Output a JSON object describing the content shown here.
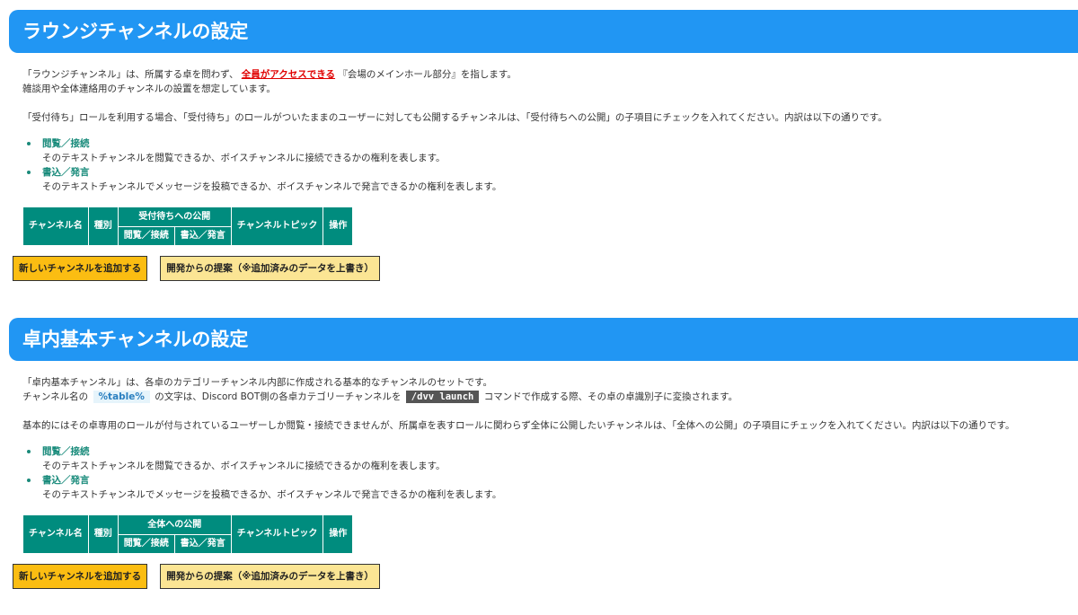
{
  "sections": [
    {
      "title": "ラウンジチャンネルの設定",
      "intro_a": "「ラウンジチャンネル」は、所属する卓を問わず、",
      "intro_highlight": "全員がアクセスできる",
      "intro_b": "『会場のメインホール部分』を指します。",
      "intro_line2": "雑談用や全体連絡用のチャンネルの設置を想定しています。",
      "note": "「受付待ち」ロールを利用する場合、「受付待ち」のロールがついたままのユーザーに対しても公開するチャンネルは、「受付待ちへの公開」の子項目にチェックを入れてください。内訳は以下の通りです。",
      "perms": [
        {
          "title": "閲覧／接続",
          "desc": "そのテキストチャンネルを閲覧できるか、ボイスチャンネルに接続できるかの権利を表します。"
        },
        {
          "title": "書込／発言",
          "desc": "そのテキストチャンネルでメッセージを投稿できるか、ボイスチャンネルで発言できるかの権利を表します。"
        }
      ],
      "table": {
        "col_name": "チャンネル名",
        "col_type": "種別",
        "col_group": "受付待ちへの公開",
        "col_view": "閲覧／接続",
        "col_write": "書込／発言",
        "col_topic": "チャンネルトピック",
        "col_ops": "操作"
      },
      "add_button": "新しいチャンネルを追加する",
      "suggest_button": "開発からの提案（※追加済みのデータを上書き）"
    },
    {
      "title": "卓内基本チャンネルの設定",
      "intro_line1": "「卓内基本チャンネル」は、各卓のカテゴリーチャンネル内部に作成される基本的なチャンネルのセットです。",
      "intro2_a": "チャンネル名の",
      "intro2_code1": "%table%",
      "intro2_b": "の文字は、Discord BOT側の各卓カテゴリーチャンネルを",
      "intro2_code2": "/dvv launch",
      "intro2_c": "コマンドで作成する際、その卓の卓識別子に変換されます。",
      "note": "基本的にはその卓専用のロールが付与されているユーザーしか閲覧・接続できませんが、所属卓を表すロールに関わらず全体に公開したいチャンネルは、「全体への公開」の子項目にチェックを入れてください。内訳は以下の通りです。",
      "perms": [
        {
          "title": "閲覧／接続",
          "desc": "そのテキストチャンネルを閲覧できるか、ボイスチャンネルに接続できるかの権利を表します。"
        },
        {
          "title": "書込／発言",
          "desc": "そのテキストチャンネルでメッセージを投稿できるか、ボイスチャンネルで発言できるかの権利を表します。"
        }
      ],
      "table": {
        "col_name": "チャンネル名",
        "col_type": "種別",
        "col_group": "全体への公開",
        "col_view": "閲覧／接続",
        "col_write": "書込／発言",
        "col_topic": "チャンネルトピック",
        "col_ops": "操作"
      },
      "add_button": "新しいチャンネルを追加する",
      "suggest_button": "開発からの提案（※追加済みのデータを上書き）"
    }
  ]
}
